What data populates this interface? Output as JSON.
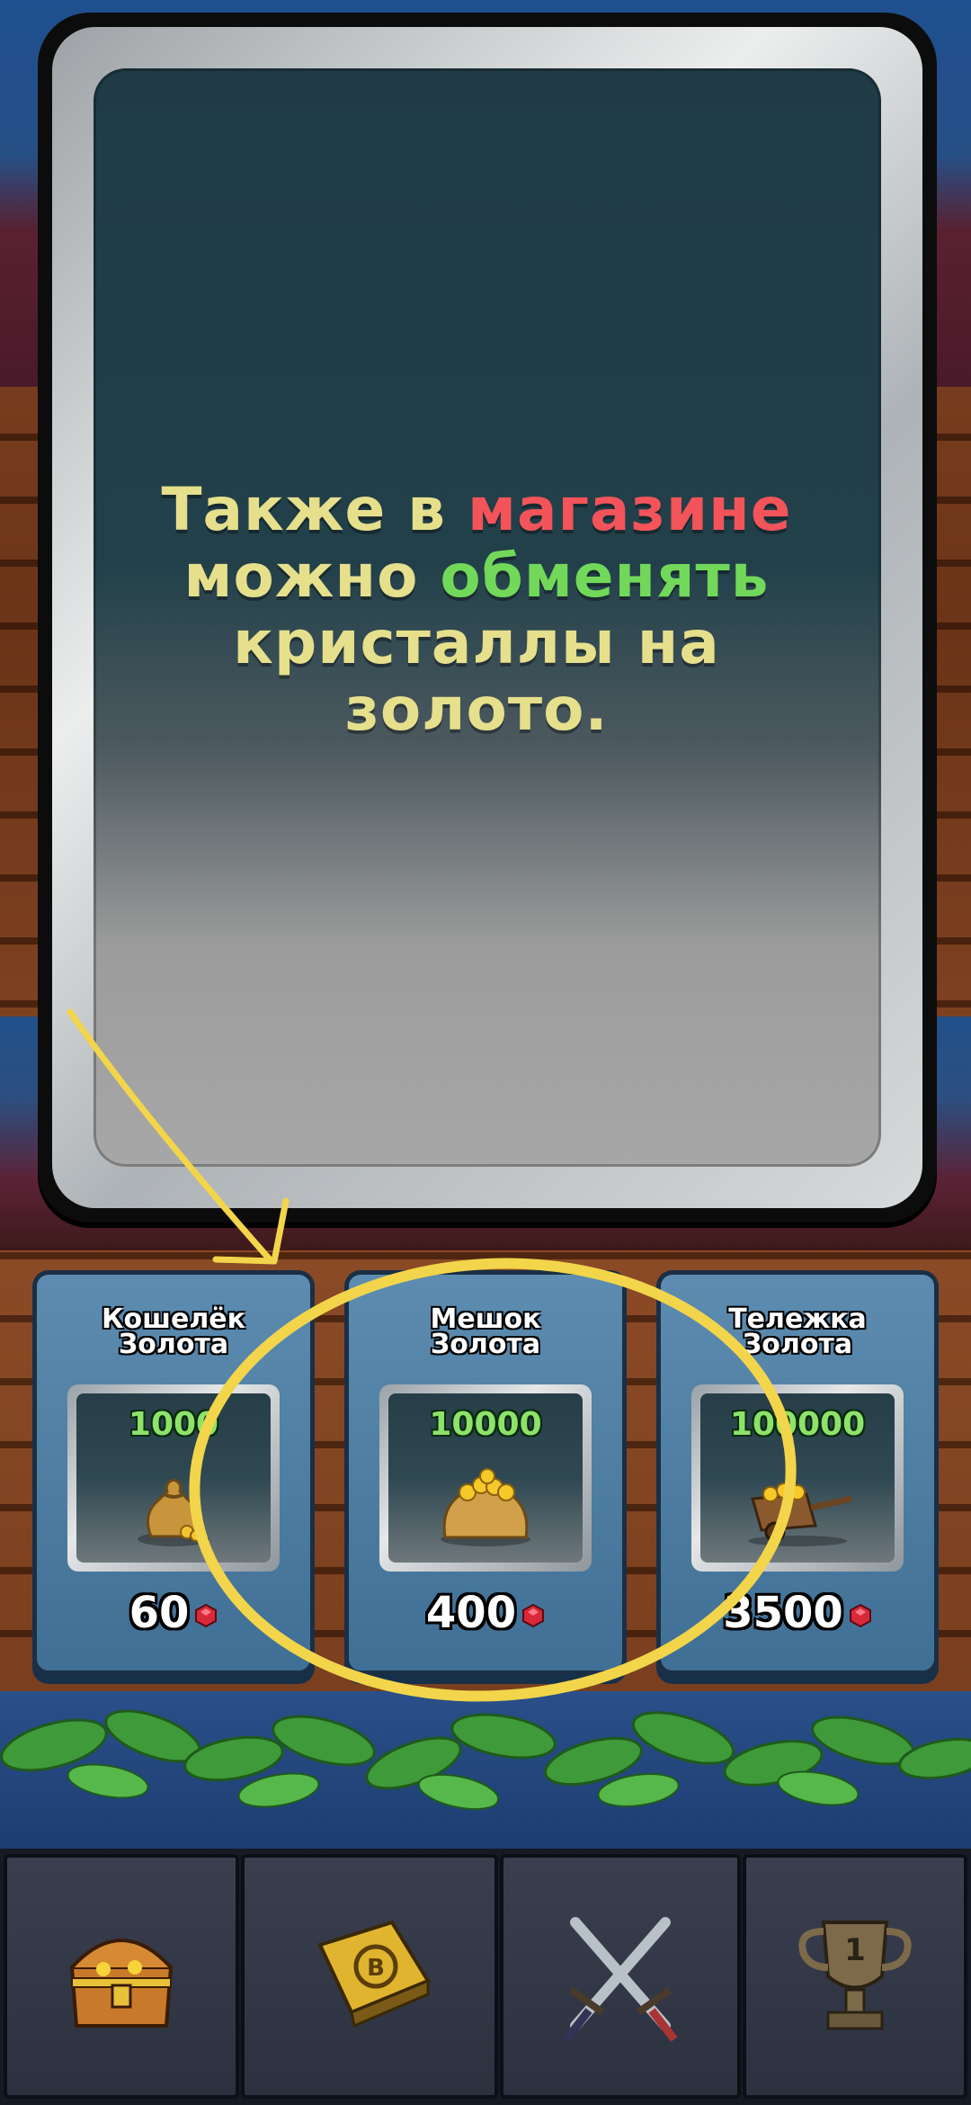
{
  "tutorial": {
    "message_part1": "Также в ",
    "message_red": "магазине",
    "message_part2": " можно ",
    "message_green": "обменять",
    "message_part3": " кристаллы на золото."
  },
  "shop": {
    "items": [
      {
        "title_line1": "Кошелёк",
        "title_line2": "Золота",
        "amount": "1000",
        "price": "60",
        "icon": "gold-pouch-icon"
      },
      {
        "title_line1": "Мешок",
        "title_line2": "Золота",
        "amount": "10000",
        "price": "400",
        "icon": "gold-sack-icon"
      },
      {
        "title_line1": "Тележка",
        "title_line2": "Золота",
        "amount": "100000",
        "price": "3500",
        "icon": "gold-cart-icon"
      }
    ],
    "currency_icon": "red-gem-icon"
  },
  "nav": {
    "tabs": [
      {
        "icon": "treasure-chest-icon"
      },
      {
        "icon": "spellbook-icon"
      },
      {
        "icon": "crossed-swords-icon"
      },
      {
        "icon": "trophy-icon",
        "rank": "1"
      }
    ]
  },
  "colors": {
    "message_text": "#e6df8c",
    "highlight_red": "#f2545a",
    "highlight_green": "#72d85a",
    "annotation_yellow": "#f2d54a",
    "amount_green": "#8de36a"
  }
}
